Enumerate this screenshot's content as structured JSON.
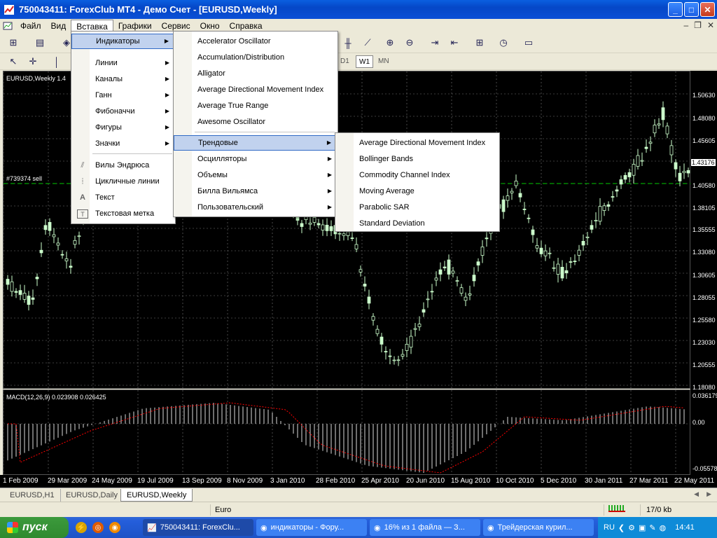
{
  "window": {
    "title": "750043411: ForexClub MT4 - Демо Счет - [EURUSD,Weekly]",
    "btn_min": "_",
    "btn_max": "□",
    "btn_close": "✕"
  },
  "menubar": {
    "items": [
      "Файл",
      "Вид",
      "Вставка",
      "Графики",
      "Сервис",
      "Окно",
      "Справка"
    ]
  },
  "toolbar2": {
    "timeframes": [
      "D1",
      "W1",
      "MN"
    ]
  },
  "chart": {
    "label": "EURUSD,Weekly  1.4",
    "order_label": "#739374 sell",
    "macd_label": "MACD(12,26,9) 0.023908 0.026425",
    "price_labels": [
      "1.50630",
      "1.48080",
      "1.45605",
      "1.43176",
      "1.40580",
      "1.38105",
      "1.35555",
      "1.33080",
      "1.30605",
      "1.28055",
      "1.25580",
      "1.23030",
      "1.20555",
      "1.18080"
    ],
    "macd_labels": [
      "0.036179",
      "0.00",
      "-0.05578"
    ],
    "dates": [
      "1 Feb 2009",
      "29 Mar 2009",
      "24 May 2009",
      "19 Jul 2009",
      "13 Sep 2009",
      "8 Nov 2009",
      "3 Jan 2010",
      "28 Feb 2010",
      "25 Apr 2010",
      "20 Jun 2010",
      "15 Aug 2010",
      "10 Oct 2010",
      "5 Dec 2010",
      "30 Jan 2011",
      "27 Mar 2011",
      "22 May 2011"
    ],
    "colors": {
      "bg": "#000000",
      "candle": "#ccffcc",
      "grid": "#777777",
      "signal": "#ff0000",
      "order": "#00cc00"
    }
  },
  "menu_main": {
    "items": [
      "Индикаторы",
      "Линии",
      "Каналы",
      "Ганн",
      "Фибоначчи",
      "Фигуры",
      "Значки",
      "Вилы Эндрюса",
      "Цикличные линии",
      "Текст",
      "Текстовая метка"
    ]
  },
  "menu_indicators": {
    "items": [
      "Accelerator Oscillator",
      "Accumulation/Distribution",
      "Alligator",
      "Average Directional Movement Index",
      "Average True Range",
      "Awesome Oscillator",
      "Трендовые",
      "Осцилляторы",
      "Объемы",
      "Билла Вильямса",
      "Пользовательский"
    ]
  },
  "menu_trend": {
    "items": [
      "Average Directional Movement Index",
      "Bollinger Bands",
      "Commodity Channel Index",
      "Moving Average",
      "Parabolic SAR",
      "Standard Deviation"
    ]
  },
  "tabs": [
    "EURUSD,H1",
    "EURUSD,Daily",
    "EURUSD,Weekly"
  ],
  "status": {
    "profile": "Euro",
    "traffic": "17/0 kb"
  },
  "taskbar": {
    "start": "пуск",
    "tasks": [
      "750043411: ForexClu...",
      "индикаторы - Фору...",
      "16% из 1 файла — З...",
      "Трейдерская курил..."
    ],
    "lang": "RU",
    "clock": "14:41"
  }
}
